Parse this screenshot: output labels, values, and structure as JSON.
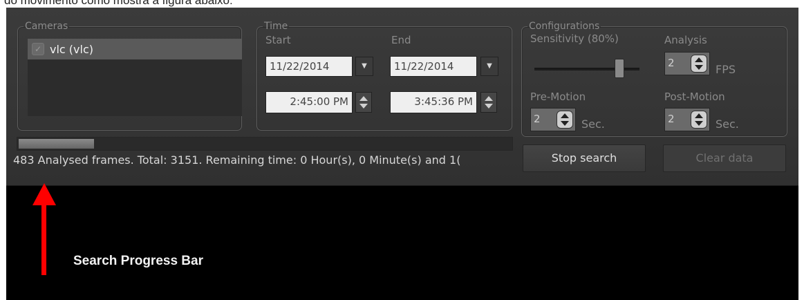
{
  "page_caption": "do movimento como mostra a figura abaixo:",
  "cameras": {
    "legend": "Cameras",
    "items": [
      {
        "label": "vlc (vlc)",
        "checked": true
      }
    ]
  },
  "time": {
    "legend": "Time",
    "start_label": "Start",
    "end_label": "End",
    "start_date": "11/22/2014",
    "end_date": "11/22/2014",
    "start_time": "2:45:00 PM",
    "end_time": "3:45:36 PM"
  },
  "configurations": {
    "legend": "Configurations",
    "sensitivity_label": "Sensitivity (80%)",
    "sensitivity_value": 80,
    "analysis_label": "Analysis",
    "analysis_value": "2",
    "analysis_unit": "FPS",
    "pre_motion_label": "Pre-Motion",
    "pre_motion_value": "2",
    "pre_motion_unit": "Sec.",
    "post_motion_label": "Post-Motion",
    "post_motion_value": "2",
    "post_motion_unit": "Sec."
  },
  "progress": {
    "fraction": 0.153,
    "status_text": "483 Analysed frames. Total: 3151. Remaining time: 0 Hour(s), 0 Minute(s) and 1("
  },
  "buttons": {
    "stop_search": "Stop search",
    "clear_data": "Clear data"
  },
  "annotation": {
    "label": "Search Progress Bar",
    "color": "#ff0000"
  }
}
